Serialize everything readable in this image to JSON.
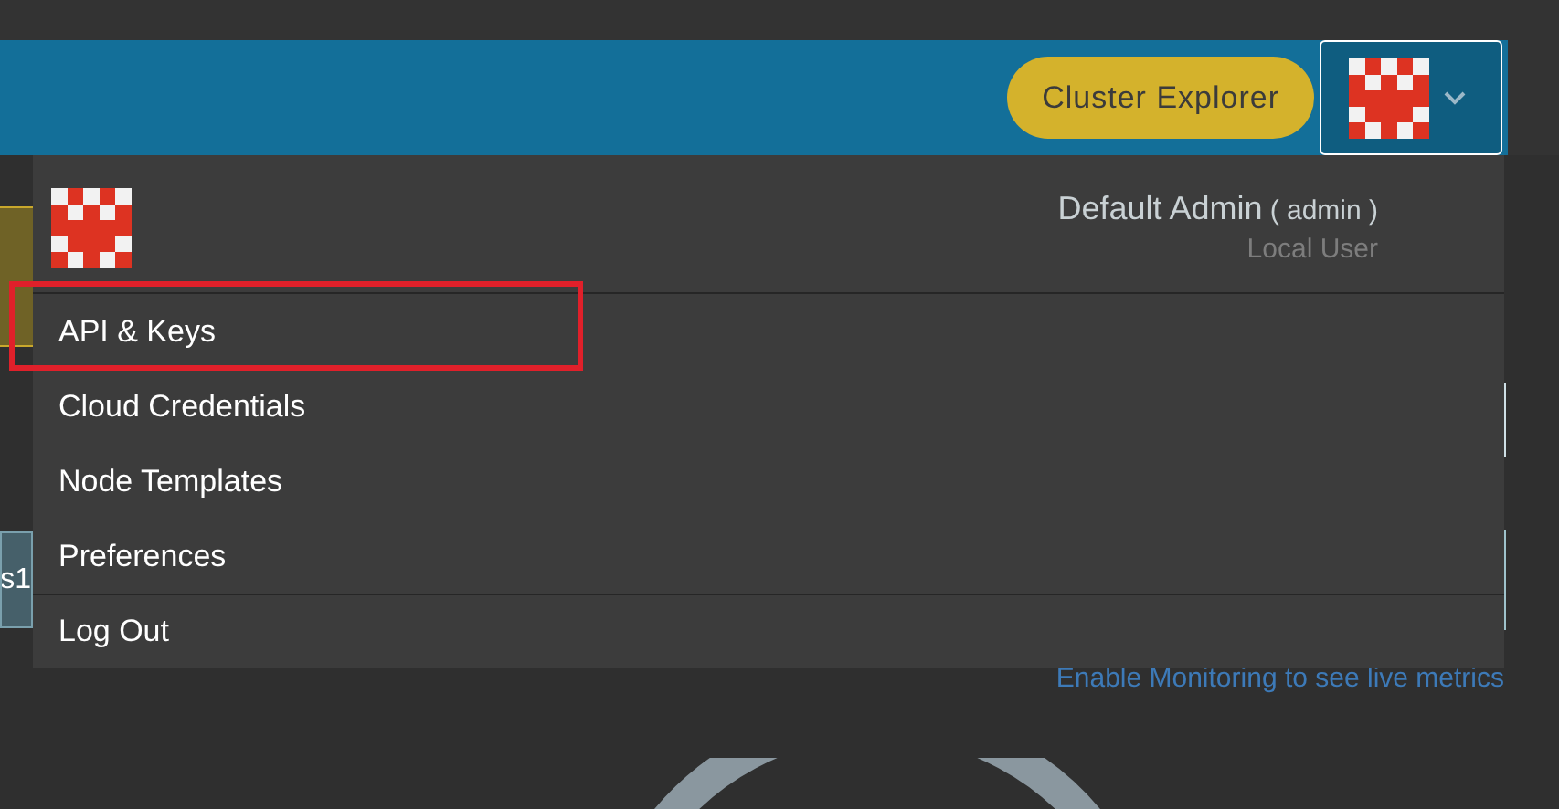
{
  "header": {
    "cluster_explorer_button": "Cluster Explorer"
  },
  "user_menu": {
    "name": "Default Admin",
    "username": "( admin )",
    "role": "Local User",
    "items": [
      {
        "label": "API & Keys",
        "highlighted": true,
        "separator_before": false
      },
      {
        "label": "Cloud Credentials",
        "highlighted": false,
        "separator_before": false
      },
      {
        "label": "Node Templates",
        "highlighted": false,
        "separator_before": false
      },
      {
        "label": "Preferences",
        "highlighted": false,
        "separator_before": false
      },
      {
        "label": "Log Out",
        "highlighted": false,
        "separator_before": true
      }
    ]
  },
  "background": {
    "tag": "s1",
    "monitoring_link": "Enable Monitoring to see live metrics"
  }
}
